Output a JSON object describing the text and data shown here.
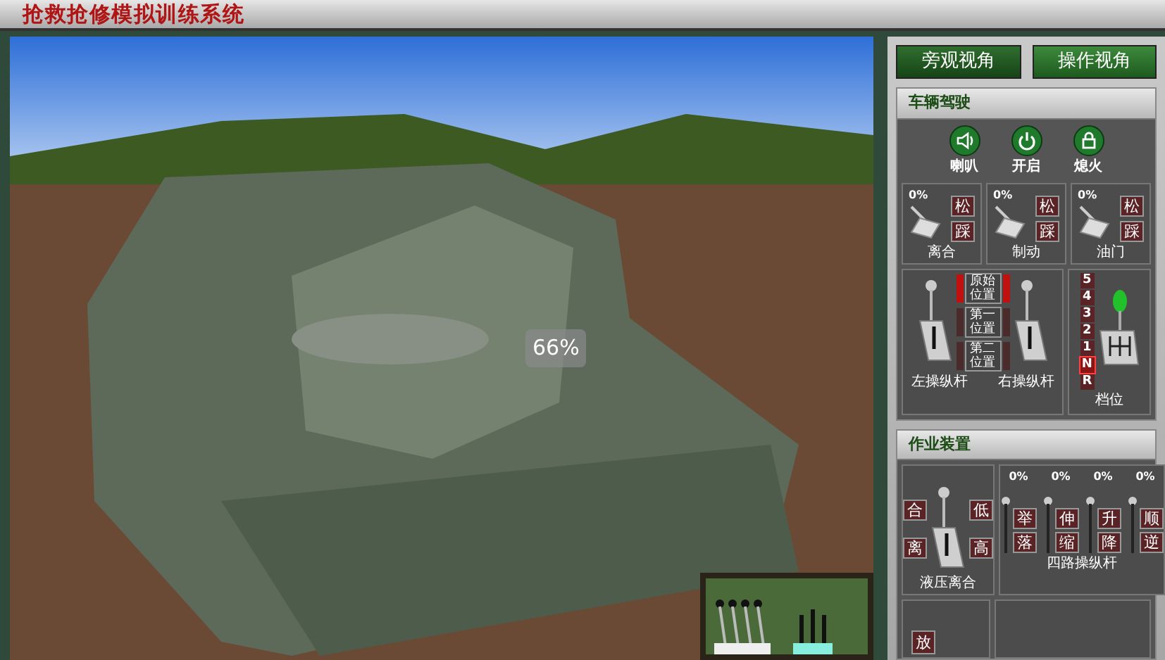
{
  "title": "抢救抢修模拟训练系统",
  "viewport": {
    "zoom_reading": "66%"
  },
  "view_buttons": [
    {
      "label": "旁观视角",
      "selected": false
    },
    {
      "label": "操作视角",
      "selected": true
    }
  ],
  "vehicle_panel": {
    "title": "车辆驾驶",
    "controls": [
      {
        "kind": "horn",
        "label": "喇叭"
      },
      {
        "kind": "power",
        "label": "开启"
      },
      {
        "kind": "lock",
        "label": "熄火"
      }
    ],
    "pedals": [
      {
        "reading": "0%",
        "release": "松",
        "press": "踩",
        "label": "离合"
      },
      {
        "reading": "0%",
        "release": "松",
        "press": "踩",
        "label": "制动"
      },
      {
        "reading": "0%",
        "release": "松",
        "press": "踩",
        "label": "油门"
      }
    ],
    "left_lever": "左操纵杆",
    "right_lever": "右操纵杆",
    "positions": [
      {
        "label": "原始位置",
        "selected": true
      },
      {
        "label": "第一位置",
        "selected": false
      },
      {
        "label": "第二位置",
        "selected": false
      }
    ],
    "gears": [
      {
        "label": "5",
        "selected": false
      },
      {
        "label": "4",
        "selected": false
      },
      {
        "label": "3",
        "selected": false
      },
      {
        "label": "2",
        "selected": false
      },
      {
        "label": "1",
        "selected": false
      },
      {
        "label": "N",
        "selected": true
      },
      {
        "label": "R",
        "selected": false
      }
    ],
    "gear_label": "档位"
  },
  "work_panel": {
    "title": "作业装置",
    "clutch": {
      "engage": "合",
      "release": "离",
      "low": "低",
      "high": "高",
      "label": "液压离合"
    },
    "four_way": {
      "label": "四路操纵杆",
      "levers": [
        {
          "reading": "0%",
          "up": "举",
          "down": "落"
        },
        {
          "reading": "0%",
          "up": "伸",
          "down": "缩"
        },
        {
          "reading": "0%",
          "up": "升",
          "down": "降"
        },
        {
          "reading": "0%",
          "up": "顺",
          "down": "逆"
        }
      ]
    },
    "row2_tag": "放"
  }
}
